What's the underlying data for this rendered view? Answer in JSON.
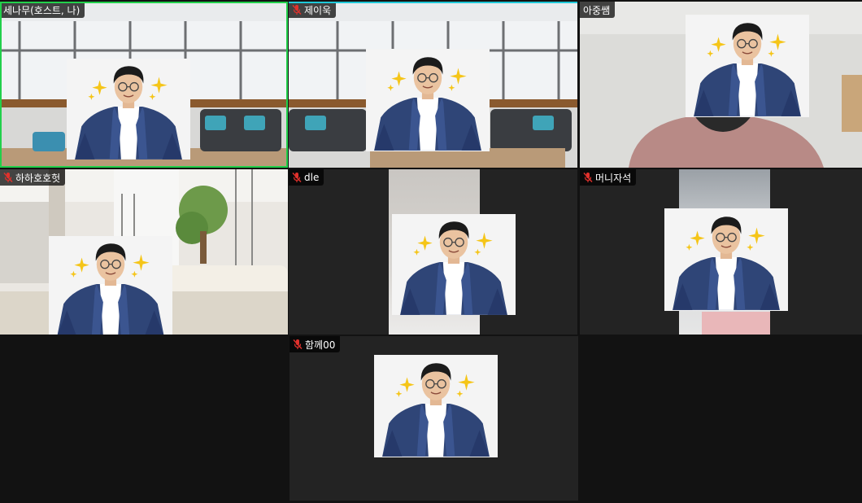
{
  "meeting": {
    "participants": [
      {
        "name": "세나무(호스트, 나)",
        "muted": false,
        "host": true
      },
      {
        "name": "제이욱",
        "muted": true
      },
      {
        "name": "아중쌤",
        "muted": false
      },
      {
        "name": "하하호호헛",
        "muted": true
      },
      {
        "name": "dle",
        "muted": true
      },
      {
        "name": "머니자석",
        "muted": true
      },
      {
        "name": "함께00",
        "muted": true
      }
    ]
  },
  "icons": {
    "muted": "mic-muted-icon",
    "sparkle": "sparkle-icon"
  },
  "colors": {
    "host_border": "#22d04b",
    "active_speaker_border": "#1fc8d8",
    "muted_icon": "#e0312c",
    "sparkle": "#f5c518",
    "suit": "#2f4577",
    "background": "#121212"
  }
}
